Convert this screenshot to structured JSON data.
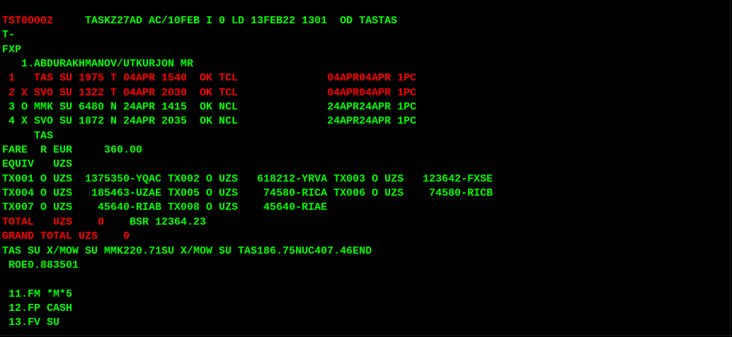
{
  "colors": {
    "background": "#000000",
    "primary": "#00ff00",
    "alert": "#ff0000"
  },
  "lines": [
    {
      "segments": [
        {
          "text": "TST00002",
          "color": "red"
        },
        {
          "text": "     TASKZ27AD AC/10FEB I 0 LD 13FEB22 1301  OD TASTAS",
          "color": "green"
        }
      ]
    },
    {
      "segments": [
        {
          "text": "T-",
          "color": "green"
        }
      ]
    },
    {
      "segments": [
        {
          "text": "FXP",
          "color": "green"
        }
      ]
    },
    {
      "segments": [
        {
          "text": "   1.ABDURAKHMANOV/UTKURJON MR",
          "color": "green"
        }
      ]
    },
    {
      "segments": [
        {
          "text": " 1   TAS SU 1975 T 04APR 1540  OK TCL              04APR04APR 1PC",
          "color": "red"
        }
      ]
    },
    {
      "segments": [
        {
          "text": " 2 X SVO SU 1322 T 04APR 2030  OK TCL              04APR04APR 1PC",
          "color": "red"
        }
      ]
    },
    {
      "segments": [
        {
          "text": " 3 O MMK SU 6480 N 24APR 1415  OK NCL              24APR24APR 1PC",
          "color": "green"
        }
      ]
    },
    {
      "segments": [
        {
          "text": " 4 X SVO SU 1872 N 24APR 2035  OK NCL              24APR24APR 1PC",
          "color": "green"
        }
      ]
    },
    {
      "segments": [
        {
          "text": "     TAS",
          "color": "green"
        }
      ]
    },
    {
      "segments": [
        {
          "text": "FARE  R EUR     360.00",
          "color": "green"
        }
      ]
    },
    {
      "segments": [
        {
          "text": "EQUIV   UZS",
          "color": "green"
        }
      ]
    },
    {
      "segments": [
        {
          "text": "TX001 O UZS  1375350-YQAC TX002 O UZS   618212-YRVA TX003 O UZS   123642-FXSE",
          "color": "green"
        }
      ]
    },
    {
      "segments": [
        {
          "text": "TX004 O UZS   185463-UZAE TX005 O UZS    74580-RICA TX006 O UZS    74580-RICB",
          "color": "green"
        }
      ]
    },
    {
      "segments": [
        {
          "text": "TX007 O UZS    45640-RIAB TX008 O UZS    45640-RIAE",
          "color": "green"
        }
      ]
    },
    {
      "segments": [
        {
          "text": "TOTAL   UZS    0",
          "color": "red"
        },
        {
          "text": "    BSR 12364.23",
          "color": "green"
        }
      ]
    },
    {
      "segments": [
        {
          "text": "GRAND TOTAL UZS    0",
          "color": "red"
        }
      ]
    },
    {
      "segments": [
        {
          "text": "TAS SU X/MOW SU MMK220.71SU X/MOW SU TAS186.75NUC407.46END",
          "color": "green"
        }
      ]
    },
    {
      "segments": [
        {
          "text": " ROE0.883501",
          "color": "green"
        }
      ]
    },
    {
      "segments": [
        {
          "text": "",
          "color": "green"
        }
      ]
    },
    {
      "segments": [
        {
          "text": " 11.FM *M*5",
          "color": "green"
        }
      ]
    },
    {
      "segments": [
        {
          "text": " 12.FP CASH",
          "color": "green"
        }
      ]
    },
    {
      "segments": [
        {
          "text": " 13.FV SU",
          "color": "green"
        }
      ]
    }
  ]
}
